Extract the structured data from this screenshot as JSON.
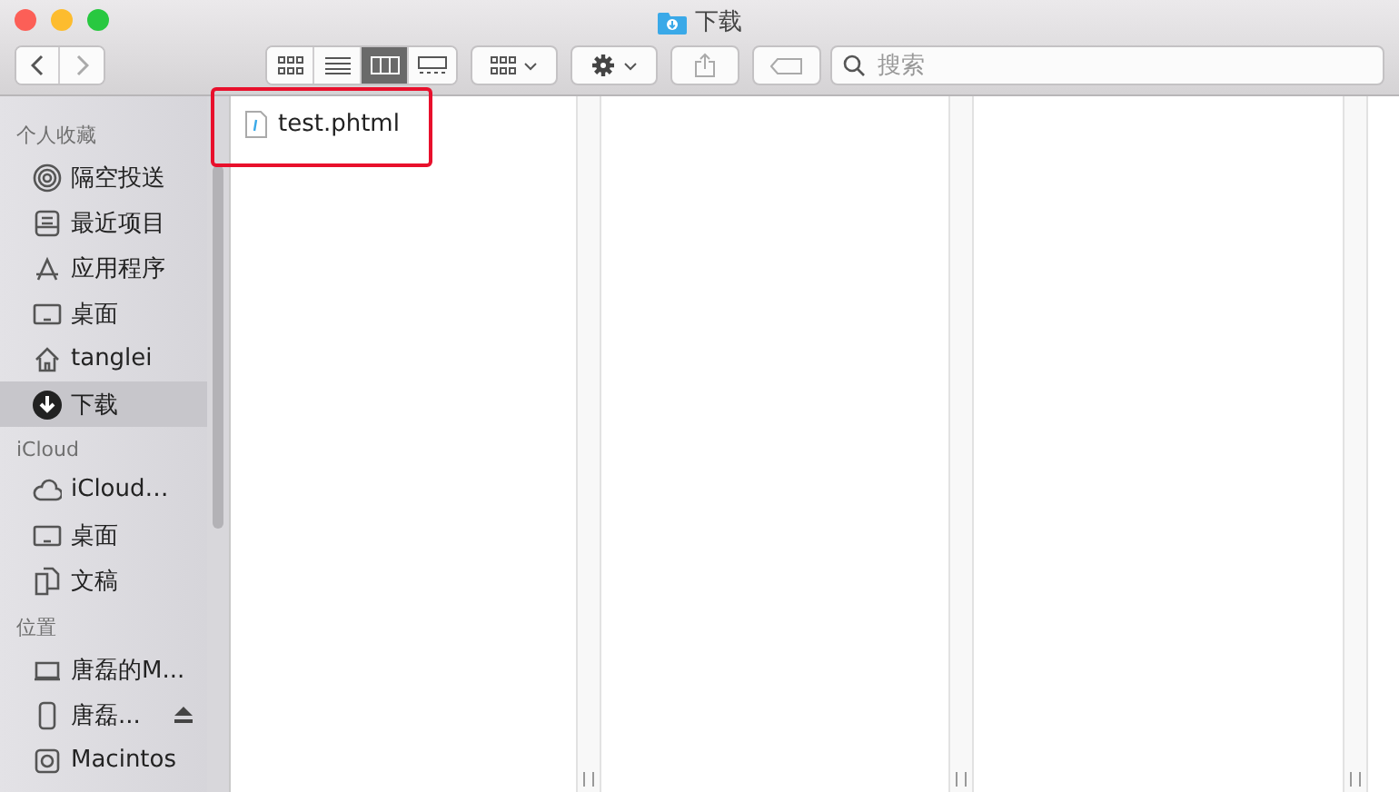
{
  "window": {
    "title": "下载"
  },
  "toolbar": {
    "views": [
      {
        "selected": false
      },
      {
        "selected": false
      },
      {
        "selected": true
      },
      {
        "selected": false
      }
    ],
    "search": {
      "placeholder": "搜索"
    }
  },
  "sidebar": {
    "sections": [
      {
        "title": "个人收藏",
        "items": [
          {
            "label": "隔空投送",
            "selected": false
          },
          {
            "label": "最近项目",
            "selected": false
          },
          {
            "label": "应用程序",
            "selected": false
          },
          {
            "label": "桌面",
            "selected": false
          },
          {
            "label": "tanglei",
            "selected": false
          },
          {
            "label": "下载",
            "selected": true
          }
        ]
      },
      {
        "title": "iCloud",
        "items": [
          {
            "label": "iCloud…",
            "selected": false
          },
          {
            "label": "桌面",
            "selected": false
          },
          {
            "label": "文稿",
            "selected": false
          }
        ]
      },
      {
        "title": "位置",
        "items": [
          {
            "label": "唐磊的M...",
            "selected": false
          },
          {
            "label": "唐磊...",
            "selected": false,
            "eject": true
          },
          {
            "label": "Macintos",
            "selected": false
          }
        ]
      }
    ]
  },
  "columns": [
    {
      "files": [
        {
          "name": "test.phtml",
          "highlighted": true
        }
      ]
    },
    {},
    {}
  ]
}
